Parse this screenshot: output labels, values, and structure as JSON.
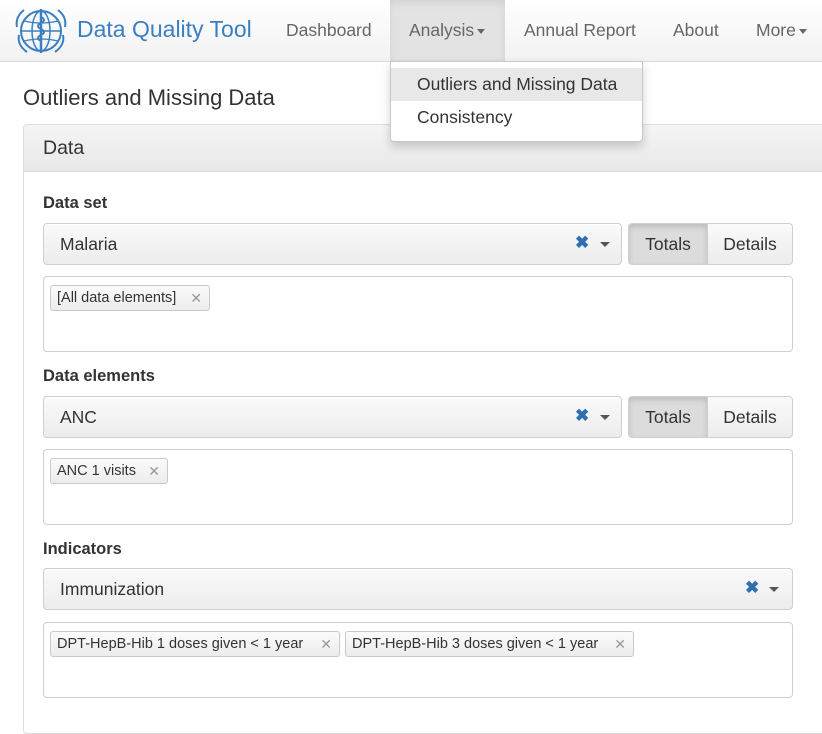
{
  "navbar": {
    "brand": "Data Quality Tool",
    "logo_icon": "who-emblem-icon",
    "items": [
      {
        "label": "Dashboard"
      },
      {
        "label": "Analysis"
      },
      {
        "label": "Annual Report"
      },
      {
        "label": "About"
      },
      {
        "label": "More"
      }
    ],
    "active_item": "Analysis",
    "brand_color": "#3a7fc1"
  },
  "analysis_menu": {
    "items": [
      {
        "label": "Outliers and Missing Data",
        "highlighted": true
      },
      {
        "label": "Consistency",
        "highlighted": false
      }
    ]
  },
  "page": {
    "title": "Outliers and Missing Data",
    "panel_title": "Data"
  },
  "sections": {
    "data_set": {
      "label": "Data set",
      "value": "Malaria",
      "toggle": {
        "totals": "Totals",
        "details": "Details",
        "selected": "Totals"
      },
      "tags": [
        "[All data elements]"
      ]
    },
    "data_elements": {
      "label": "Data elements",
      "value": "ANC",
      "toggle": {
        "totals": "Totals",
        "details": "Details",
        "selected": "Totals"
      },
      "tags": [
        "ANC 1 visits"
      ]
    },
    "indicators": {
      "label": "Indicators",
      "value": "Immunization",
      "tags": [
        "DPT-HepB-Hib 1 doses given < 1 year",
        "DPT-HepB-Hib 3 doses given < 1 year"
      ]
    }
  },
  "colors": {
    "accent": "#2d6fb0",
    "clear_icon": "#2d6fb0"
  }
}
